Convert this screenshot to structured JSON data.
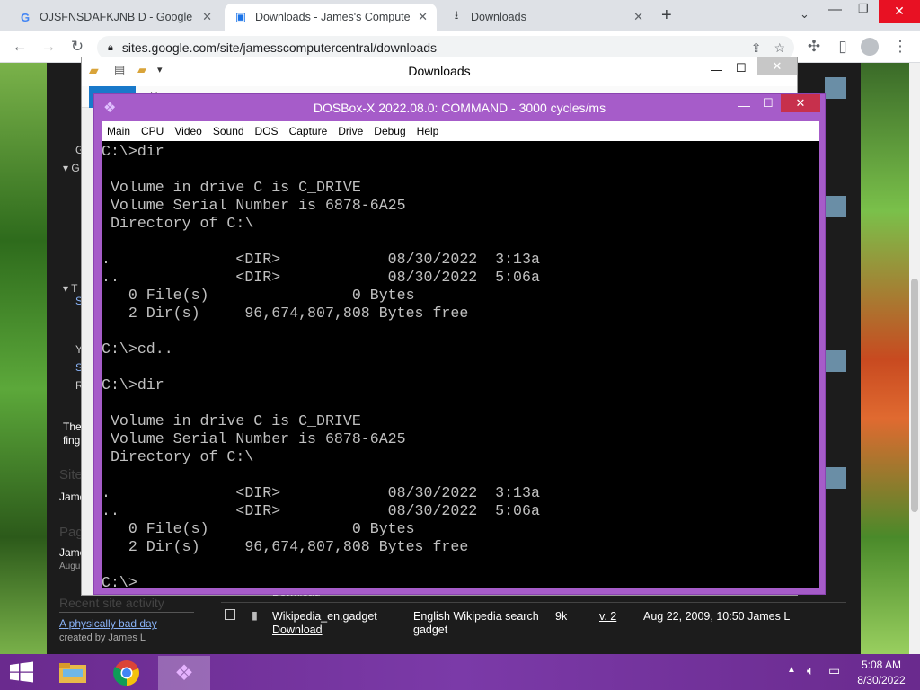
{
  "browser": {
    "tabs": [
      {
        "label": "OJSFNSDAFKJNB D - Google Sea",
        "icon": "google-g-icon"
      },
      {
        "label": "Downloads - James's Computer C",
        "icon": "sites-page-icon"
      },
      {
        "label": "Downloads",
        "icon": "download-arrow-icon"
      }
    ],
    "new_tab": "+",
    "address": "sites.google.com/site/jamesscomputercentral/downloads"
  },
  "background_page": {
    "side_letters": [
      "G",
      "G",
      "T",
      "S",
      "Y",
      "S",
      "R"
    ],
    "caption_line1": "The",
    "caption_line2": "fing",
    "site_heading": "Site",
    "site_author": "Jame",
    "pages_heading": "Pag",
    "pages_author": "Jame",
    "pages_date": "Augu",
    "recent_heading": "Recent site activity",
    "recent_link": "A physically bad day",
    "recent_by": "created by James L",
    "hidden_link": "Download",
    "file_row": {
      "name": "Wikipedia_en.gadget",
      "download": "Download",
      "desc_line1": "English Wikipedia search",
      "desc_line2": "gadget",
      "size": "9k",
      "version": "v. 2",
      "date": "Aug 22, 2009, 10:50 James L"
    }
  },
  "explorer": {
    "title": "Downloads",
    "ribbon_file": "File",
    "ribbon_home": "Home"
  },
  "dosbox": {
    "title": "DOSBox-X 2022.08.0: COMMAND - 3000 cycles/ms",
    "menu": [
      "Main",
      "CPU",
      "Video",
      "Sound",
      "DOS",
      "Capture",
      "Drive",
      "Debug",
      "Help"
    ],
    "lines": [
      "C:\\>dir",
      "",
      " Volume in drive C is C_DRIVE",
      " Volume Serial Number is 6878-6A25",
      " Directory of C:\\",
      "",
      ".              <DIR>            08/30/2022  3:13a",
      "..             <DIR>            08/30/2022  5:06a",
      "   0 File(s)                0 Bytes",
      "   2 Dir(s)     96,674,807,808 Bytes free",
      "",
      "C:\\>cd..",
      "",
      "C:\\>dir",
      "",
      " Volume in drive C is C_DRIVE",
      " Volume Serial Number is 6878-6A25",
      " Directory of C:\\",
      "",
      ".              <DIR>            08/30/2022  3:13a",
      "..             <DIR>            08/30/2022  5:06a",
      "   0 File(s)                0 Bytes",
      "   2 Dir(s)     96,674,807,808 Bytes free",
      "",
      "C:\\>"
    ]
  },
  "taskbar": {
    "time": "5:08 AM",
    "date": "8/30/2022"
  }
}
